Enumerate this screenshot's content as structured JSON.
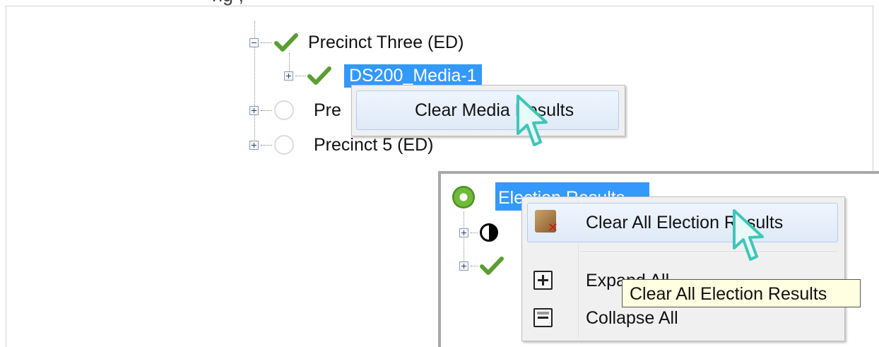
{
  "top_cut_text": "ng ,",
  "tree1": {
    "nodes": [
      {
        "label": "Precinct Three (ED)"
      },
      {
        "label": "DS200_Media-1"
      },
      {
        "label": "Pre"
      },
      {
        "label": "Precinct 5 (ED)"
      }
    ]
  },
  "menu1": {
    "items": [
      {
        "label": "Clear Media Results"
      }
    ]
  },
  "tree2": {
    "root_label": "Election Results"
  },
  "menu2": {
    "items": [
      {
        "label": "Clear All Election Results",
        "icon": "clear-results-icon"
      },
      {
        "label": "Expand All",
        "icon": "expand-all-icon"
      },
      {
        "label": "Collapse All",
        "icon": "collapse-all-icon"
      }
    ]
  },
  "tooltip": {
    "text": "Clear All Election Results"
  },
  "colors": {
    "selection": "#3399ff",
    "check": "#5a9e32",
    "cursor": "#3fc6b8"
  }
}
